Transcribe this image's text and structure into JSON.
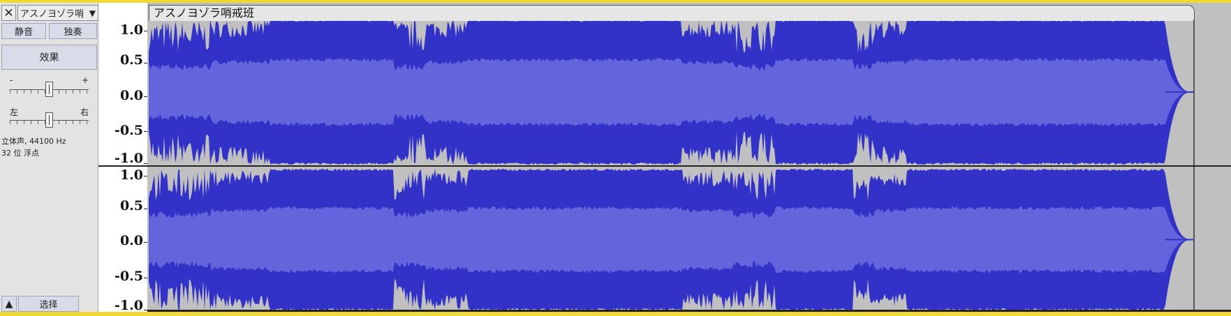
{
  "track": {
    "close_glyph": "✕",
    "name_short": "アスノヨゾラ哨",
    "name_dropdown_glyph": "▼",
    "title": "アスノヨゾラ哨戒班",
    "mute_label": "静音",
    "solo_label": "独奏",
    "effects_label": "效果",
    "gain_minus": "-",
    "gain_plus": "+",
    "pan_left": "左",
    "pan_right": "右",
    "format_line1": "立体声, 44100 Hz",
    "format_line2": "32 位 浮点",
    "collapse_glyph": "▲",
    "select_label": "选择"
  },
  "sliders": {
    "gain_position": 0.5,
    "pan_position": 0.5
  },
  "ruler": {
    "channel1": [
      "1.0",
      "0.5",
      "0.0",
      "-0.5",
      "-1.0"
    ],
    "channel2": [
      "1.0",
      "0.5",
      "0.0",
      "-0.5",
      "-1.0"
    ]
  },
  "waveform": {
    "color_peak": "#3232c8",
    "color_rms": "#6464dc",
    "color_background": "#c0c0c0",
    "loud_sections": [
      [
        0.0,
        0.06
      ],
      [
        0.235,
        0.265
      ],
      [
        0.56,
        0.6
      ],
      [
        0.675,
        0.695
      ]
    ],
    "quiet_sections": [
      [
        0.06,
        0.115
      ],
      [
        0.265,
        0.305
      ],
      [
        0.51,
        0.56
      ],
      [
        0.695,
        0.725
      ]
    ],
    "clip_end": 0.973,
    "fade_end": 1.0
  }
}
